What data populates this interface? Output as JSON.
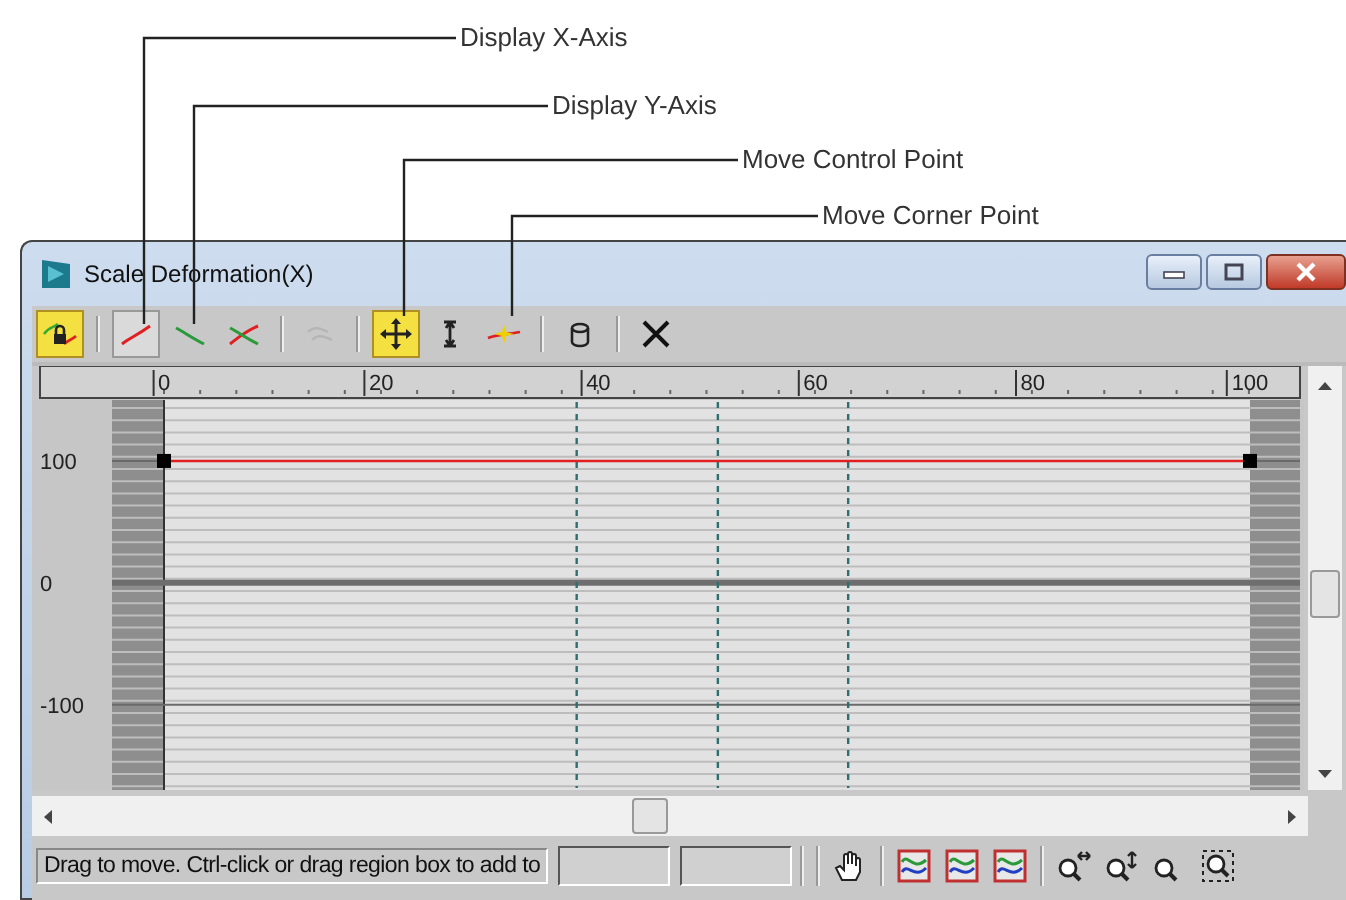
{
  "callouts": [
    {
      "label": "Display X-Axis"
    },
    {
      "label": "Display Y-Axis"
    },
    {
      "label": "Move Control Point"
    },
    {
      "label": "Move Corner Point"
    }
  ],
  "window": {
    "title": "Scale Deformation(X)"
  },
  "toolbar": [
    [
      {
        "kind": "lock",
        "selected": true,
        "disabled": false
      }
    ],
    [
      {
        "kind": "x-axis",
        "selected": true,
        "disabled": false
      },
      {
        "kind": "y-axis",
        "selected": false,
        "disabled": false
      },
      {
        "kind": "xy-axis",
        "selected": false,
        "disabled": false
      }
    ],
    [
      {
        "kind": "swap",
        "selected": false,
        "disabled": true
      }
    ],
    [
      {
        "kind": "move",
        "selected": true,
        "disabled": false
      },
      {
        "kind": "scale",
        "selected": false,
        "disabled": false
      },
      {
        "kind": "corner",
        "selected": false,
        "disabled": false
      }
    ],
    [
      {
        "kind": "reset",
        "selected": false,
        "disabled": false
      }
    ],
    [
      {
        "kind": "delete",
        "selected": false,
        "disabled": false
      }
    ]
  ],
  "chart_data": {
    "type": "line",
    "x": [
      0,
      100
    ],
    "series": [
      {
        "color": "#e02020",
        "marker": "square",
        "values": [
          100,
          100
        ]
      }
    ],
    "xlim": [
      0,
      100
    ],
    "ylim": [
      -170,
      150
    ],
    "xticks": [
      0,
      20,
      40,
      60,
      80,
      100
    ],
    "yticks": [
      -100,
      0,
      100
    ],
    "ref_lines": [
      {
        "axis": "x",
        "value": 38
      },
      {
        "axis": "x",
        "value": 51
      },
      {
        "axis": "x",
        "value": 63
      }
    ]
  },
  "status_bar": {
    "message": "Drag to move. Ctrl-click or drag region box to add to",
    "tools": [
      [
        {
          "kind": "pan"
        }
      ],
      [
        {
          "kind": "zoom-extents"
        },
        {
          "kind": "zoom-horizontal-extents"
        },
        {
          "kind": "zoom-value-extents"
        }
      ],
      [
        {
          "kind": "zoom-horizontal"
        },
        {
          "kind": "zoom-value"
        },
        {
          "kind": "zoom"
        },
        {
          "kind": "zoom-region"
        }
      ]
    ]
  }
}
